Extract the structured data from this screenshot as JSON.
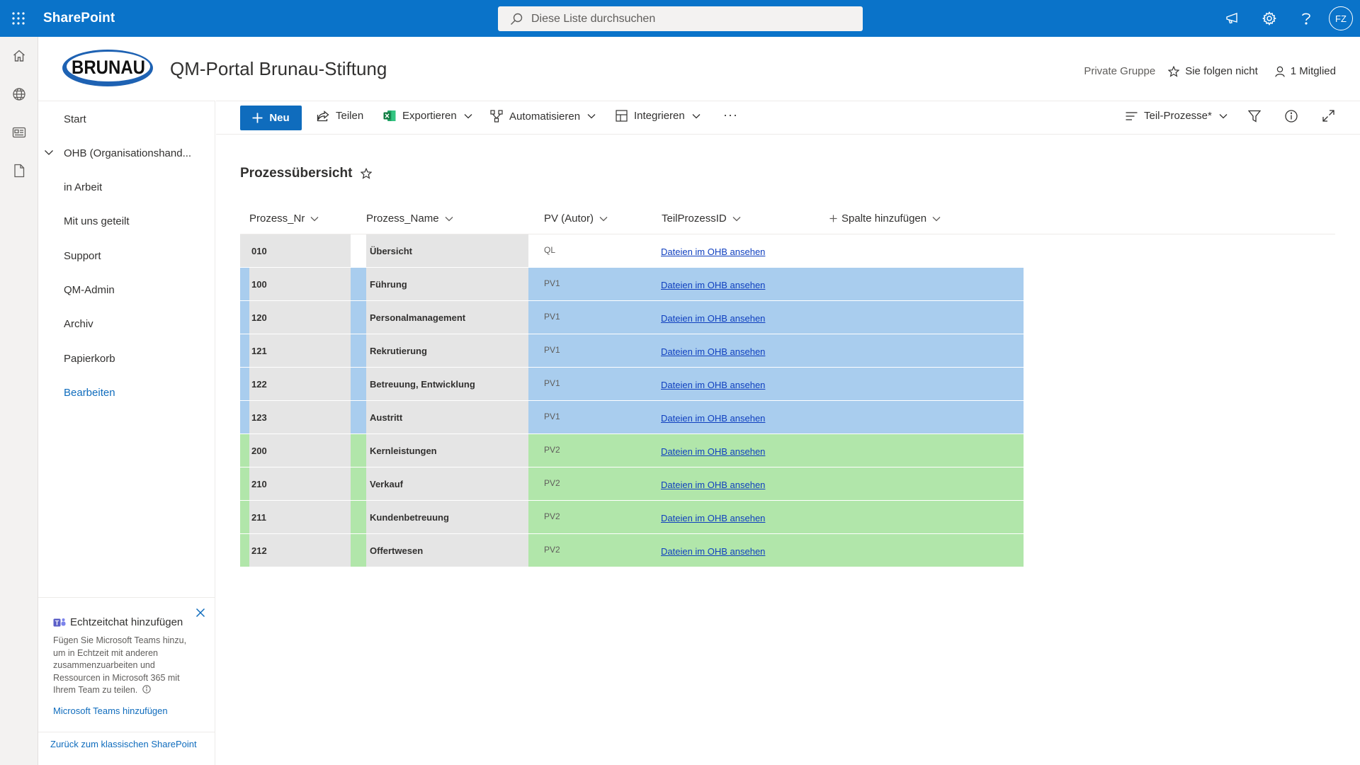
{
  "suite": {
    "brand": "SharePoint",
    "search_placeholder": "Diese Liste durchsuchen",
    "avatar_initials": "FZ",
    "accent_color": "#0a73c9"
  },
  "site": {
    "logo_text": "BRUNAU",
    "title": "QM-Portal Brunau-Stiftung",
    "group_type": "Private Gruppe",
    "follow_label": "Sie folgen nicht",
    "members_label": "1 Mitglied"
  },
  "nav": {
    "items": [
      {
        "label": "Start"
      },
      {
        "label": "OHB (Organisationshand..."
      },
      {
        "label": "in Arbeit"
      },
      {
        "label": "Mit uns geteilt"
      },
      {
        "label": "Support"
      },
      {
        "label": "QM-Admin"
      },
      {
        "label": "Archiv"
      },
      {
        "label": "Papierkorb"
      },
      {
        "label": "Bearbeiten"
      }
    ],
    "teams_card": {
      "title": "Echtzeitchat hinzufügen",
      "body": "Fügen Sie Microsoft Teams hinzu, um in Echtzeit mit anderen zusammenzuarbeiten und Ressourcen in Microsoft 365 mit Ihrem Team zu teilen.",
      "link": "Microsoft Teams hinzufügen"
    },
    "classic_link": "Zurück zum klassischen SharePoint"
  },
  "commandbar": {
    "new_label": "Neu",
    "share_label": "Teilen",
    "export_label": "Exportieren",
    "automate_label": "Automatisieren",
    "integrate_label": "Integrieren",
    "more_label": "···",
    "view_label": "Teil-Prozesse*"
  },
  "view": {
    "title": "Prozessübersicht"
  },
  "list": {
    "columns": {
      "nr": "Prozess_Nr",
      "name": "Prozess_Name",
      "pv": "PV (Autor)",
      "teilprozess": "TeilProzessID",
      "add": "Spalte hinzufügen"
    },
    "colors": {
      "ql_accent": "#e5e5e5",
      "pv1_bg": "#a9cdee",
      "pv1_accent": "#a9cdee",
      "pv2_bg": "#b1e6aa",
      "pv2_accent": "#b1e6aa"
    },
    "rows": [
      {
        "nr": "010",
        "name": "Übersicht",
        "pv": "QL",
        "link": "Dateien im OHB ansehen"
      },
      {
        "nr": "100",
        "name": "Führung",
        "pv": "PV1",
        "link": "Dateien im OHB ansehen"
      },
      {
        "nr": "120",
        "name": "Personalmanagement",
        "pv": "PV1",
        "link": "Dateien im OHB ansehen"
      },
      {
        "nr": "121",
        "name": "Rekrutierung",
        "pv": "PV1",
        "link": "Dateien im OHB ansehen"
      },
      {
        "nr": "122",
        "name": "Betreuung, Entwicklung",
        "pv": "PV1",
        "link": "Dateien im OHB ansehen"
      },
      {
        "nr": "123",
        "name": "Austritt",
        "pv": "PV1",
        "link": "Dateien im OHB ansehen"
      },
      {
        "nr": "200",
        "name": "Kernleistungen",
        "pv": "PV2",
        "link": "Dateien im OHB ansehen"
      },
      {
        "nr": "210",
        "name": "Verkauf",
        "pv": "PV2",
        "link": "Dateien im OHB ansehen"
      },
      {
        "nr": "211",
        "name": "Kundenbetreuung",
        "pv": "PV2",
        "link": "Dateien im OHB ansehen"
      },
      {
        "nr": "212",
        "name": "Offertwesen",
        "pv": "PV2",
        "link": "Dateien im OHB ansehen"
      }
    ]
  }
}
